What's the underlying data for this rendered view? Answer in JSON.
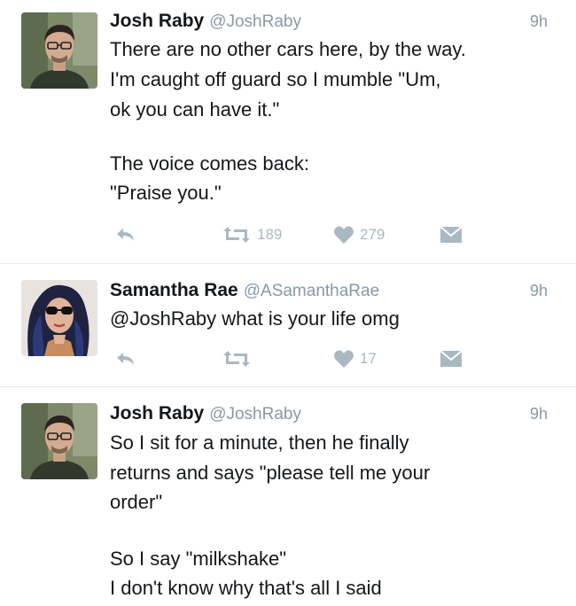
{
  "tweets": [
    {
      "name": "Josh Raby",
      "handle": "@JoshRaby",
      "time": "9h",
      "lines": [
        "There are no other cars here, by the way.",
        "I'm caught off guard so I mumble \"Um,",
        "ok you can have it.\"",
        "",
        "The voice comes back:",
        "\"Praise you.\""
      ],
      "retweets": "189",
      "likes": "279",
      "avatar": "josh-avatar"
    },
    {
      "name": "Samantha Rae",
      "handle": "@ASamanthaRae",
      "time": "9h",
      "lines": [
        "@JoshRaby what is your life omg"
      ],
      "retweets": "",
      "likes": "17",
      "avatar": "samantha-avatar"
    },
    {
      "name": "Josh Raby",
      "handle": "@JoshRaby",
      "time": "9h",
      "lines": [
        "So I sit for a minute, then he finally",
        "returns and says \"please tell me your",
        "order\"",
        "",
        "So I say \"milkshake\"",
        "I don't know why that's all I said"
      ],
      "avatar": "josh-avatar"
    }
  ],
  "icons": {
    "reply": "reply-arrow-icon",
    "retweet": "retweet-icon",
    "like": "heart-icon",
    "message": "envelope-icon"
  },
  "colors": {
    "text": "#14171a",
    "muted": "#8899a6",
    "icon": "#aab8c2",
    "divider": "#e1e8ed"
  }
}
